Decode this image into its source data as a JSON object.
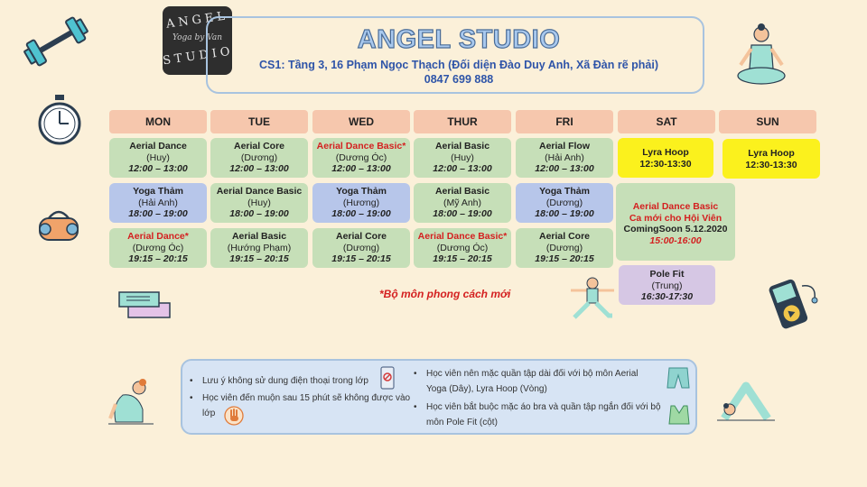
{
  "header": {
    "logo_top": "ANGEL",
    "logo_script": "Yoga by Van",
    "logo_bottom": "STUDIO",
    "title": "ANGEL STUDIO",
    "address": "CS1: Tầng 3, 16 Phạm Ngọc Thạch (Đối diện Đào Duy Anh, Xã Đàn rẽ phải)",
    "phone": "0847 699 888"
  },
  "days": [
    "MON",
    "TUE",
    "WED",
    "THUR",
    "FRI",
    "SAT",
    "SUN"
  ],
  "schedule": {
    "mon1": {
      "name": "Aerial Dance",
      "teacher": "(Huy)",
      "time": "12:00 – 13:00"
    },
    "mon2": {
      "name": "Yoga Thảm",
      "teacher": "(Hải Anh)",
      "time": "18:00 – 19:00"
    },
    "mon3": {
      "name": "Aerial Dance*",
      "teacher": "(Dương Óc)",
      "time": "19:15 – 20:15"
    },
    "tue1": {
      "name": "Aerial Core",
      "teacher": "(Dương)",
      "time": "12:00 – 13:00"
    },
    "tue2": {
      "name": "Aerial Dance Basic",
      "teacher": "(Huy)",
      "time": "18:00 – 19:00"
    },
    "tue3": {
      "name": "Aerial Basic",
      "teacher": "(Hướng Phạm)",
      "time": "19:15 – 20:15"
    },
    "wed1": {
      "name": "Aerial Dance Basic*",
      "teacher": "(Dương Óc)",
      "time": "12:00 – 13:00"
    },
    "wed2": {
      "name": "Yoga Thảm",
      "teacher": "(Hương)",
      "time": "18:00 – 19:00"
    },
    "wed3": {
      "name": "Aerial Core",
      "teacher": "(Dương)",
      "time": "19:15 – 20:15"
    },
    "thu1": {
      "name": "Aerial Basic",
      "teacher": "(Huy)",
      "time": "12:00 – 13:00"
    },
    "thu2": {
      "name": "Aerial Basic",
      "teacher": "(Mỹ Anh)",
      "time": "18:00 – 19:00"
    },
    "thu3": {
      "name": "Aerial Dance Basic*",
      "teacher": "(Dương Óc)",
      "time": "19:15 – 20:15"
    },
    "fri1": {
      "name": "Aerial Flow",
      "teacher": "(Hải Anh)",
      "time": "12:00 – 13:00"
    },
    "fri2": {
      "name": "Yoga Thảm",
      "teacher": "(Dương)",
      "time": "18:00 – 19:00"
    },
    "fri3": {
      "name": "Aerial Core",
      "teacher": "(Dương)",
      "time": "19:15 – 20:15"
    },
    "sat1": {
      "name": "Lyra Hoop",
      "time": "12:30-13:30"
    },
    "sat2": {
      "name": "Aerial Dance Basic",
      "sub": "Ca mới cho Hội Viên",
      "coming": "ComingSoon 5.12.2020",
      "time": "15:00-16:00"
    },
    "sat3": {
      "name": "Pole Fit",
      "teacher": "(Trung)",
      "time": "16:30-17:30"
    },
    "sun1": {
      "name": "Lyra Hoop",
      "time": "12:30-13:30"
    }
  },
  "note_new": "*Bộ môn phong cách mới",
  "rules": {
    "r1": "Lưu ý không sử dung điện thoại trong lớp",
    "r2a": "Học viên đến muộn sau 15 phút sẽ không được vào",
    "r2b": "lớp",
    "r3a": "Học viên nên mặc quần tập dài đối với bộ môn Aerial",
    "r3b": "Yoga (Dây), Lyra Hoop (Vòng)",
    "r4a": "Học viên bắt buộc mặc áo bra và quần tập ngắn đối với bộ",
    "r4b": "môn Pole Fit (cột)"
  },
  "colors": {
    "green": "#c6dfb8",
    "blue": "#b7c6ea",
    "yellow": "#fbf11d",
    "purple": "#d6c7e4",
    "header": "#f6c7ad",
    "red": "#d42020"
  },
  "icons": [
    "dumbbell-icon",
    "stopwatch-icon",
    "gym-bag-icon",
    "yoga-mat-icon",
    "meditation-figure-icon",
    "warrior-pose-figure-icon",
    "music-player-icon",
    "child-pose-figure-icon",
    "downward-dog-figure-icon",
    "no-phone-icon",
    "stop-hand-icon",
    "long-pants-icon",
    "sports-bra-icon"
  ]
}
